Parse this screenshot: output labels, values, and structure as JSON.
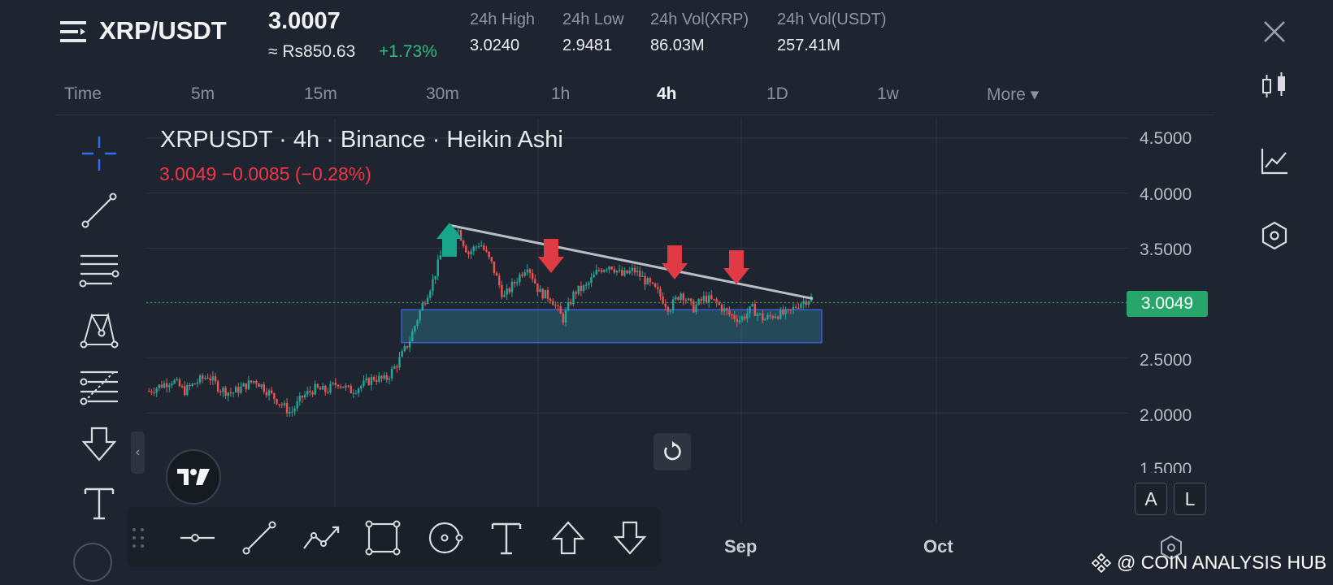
{
  "header": {
    "pair": "XRP/USDT",
    "last_price": "3.0007",
    "inr_price": "≈ Rs850.63",
    "change_pct": "+1.73%",
    "stats": [
      {
        "label": "24h High",
        "value": "3.0240"
      },
      {
        "label": "24h Low",
        "value": "2.9481"
      },
      {
        "label": "24h Vol(XRP)",
        "value": "86.03M"
      },
      {
        "label": "24h Vol(USDT)",
        "value": "257.41M"
      }
    ]
  },
  "timeframes": [
    {
      "label": "Time",
      "active": false
    },
    {
      "label": "5m",
      "active": false
    },
    {
      "label": "15m",
      "active": false
    },
    {
      "label": "30m",
      "active": false
    },
    {
      "label": "1h",
      "active": false
    },
    {
      "label": "4h",
      "active": true
    },
    {
      "label": "1D",
      "active": false
    },
    {
      "label": "1w",
      "active": false
    },
    {
      "label": "More ▾",
      "active": false
    }
  ],
  "chart": {
    "title": "XRPUSDT · 4h · Binance · Heikin Ashi",
    "ohlc": "3.0049  −0.0085 (−0.28%)",
    "price_tag": "3.0049",
    "x_labels": [
      "Sep",
      "Oct"
    ],
    "colors": {
      "up": "#26a69a",
      "down": "#ef5350",
      "zone": "#2e8fa8",
      "trend": "#b9bec6",
      "arrow_down": "#e03a44",
      "arrow_up": "#18a68a"
    }
  },
  "chart_data": {
    "type": "candlestick",
    "title": "XRPUSDT · 4h · Binance · Heikin Ashi",
    "y_ticks": [
      "4.5000",
      "4.0000",
      "3.5000",
      "3.0000",
      "2.5000",
      "2.0000",
      "1.5000"
    ],
    "ylim": [
      1.5,
      4.5
    ],
    "x_ticks": [
      "Sep",
      "Oct"
    ],
    "last_price": 3.0049,
    "price_path": [
      2.2,
      2.25,
      2.3,
      2.2,
      2.28,
      2.34,
      2.22,
      2.18,
      2.24,
      2.3,
      2.2,
      2.1,
      2.0,
      2.15,
      2.22,
      2.2,
      2.28,
      2.2,
      2.25,
      2.32,
      2.3,
      2.45,
      2.65,
      2.95,
      3.2,
      3.55,
      3.7,
      3.45,
      3.55,
      3.35,
      3.05,
      3.2,
      3.35,
      3.1,
      3.05,
      2.85,
      3.1,
      3.15,
      3.3,
      3.35,
      3.25,
      3.3,
      3.2,
      3.1,
      2.95,
      3.1,
      2.95,
      3.05,
      3.0,
      2.9,
      2.85,
      2.95,
      2.85,
      2.9,
      2.9,
      3.0,
      3.05
    ],
    "support_zone": [
      2.64,
      2.94
    ],
    "grid": true
  },
  "left_tools": [
    "crosshair-icon",
    "trend-line-icon",
    "horizontal-lines-icon",
    "pattern-icon",
    "fib-icon",
    "arrow-down-icon",
    "text-icon"
  ],
  "right_tools": [
    "candle-type-icon",
    "indicators-icon",
    "settings-hex-icon"
  ],
  "bottom_tools": [
    "horizontal-ray-icon",
    "line-icon",
    "path-icon",
    "rectangle-icon",
    "circle-icon",
    "text-icon",
    "arrow-up-icon",
    "arrow-down-icon"
  ],
  "buttons": {
    "auto": "A",
    "log": "L"
  },
  "watermark": "@ COIN ANALYSIS HUB"
}
